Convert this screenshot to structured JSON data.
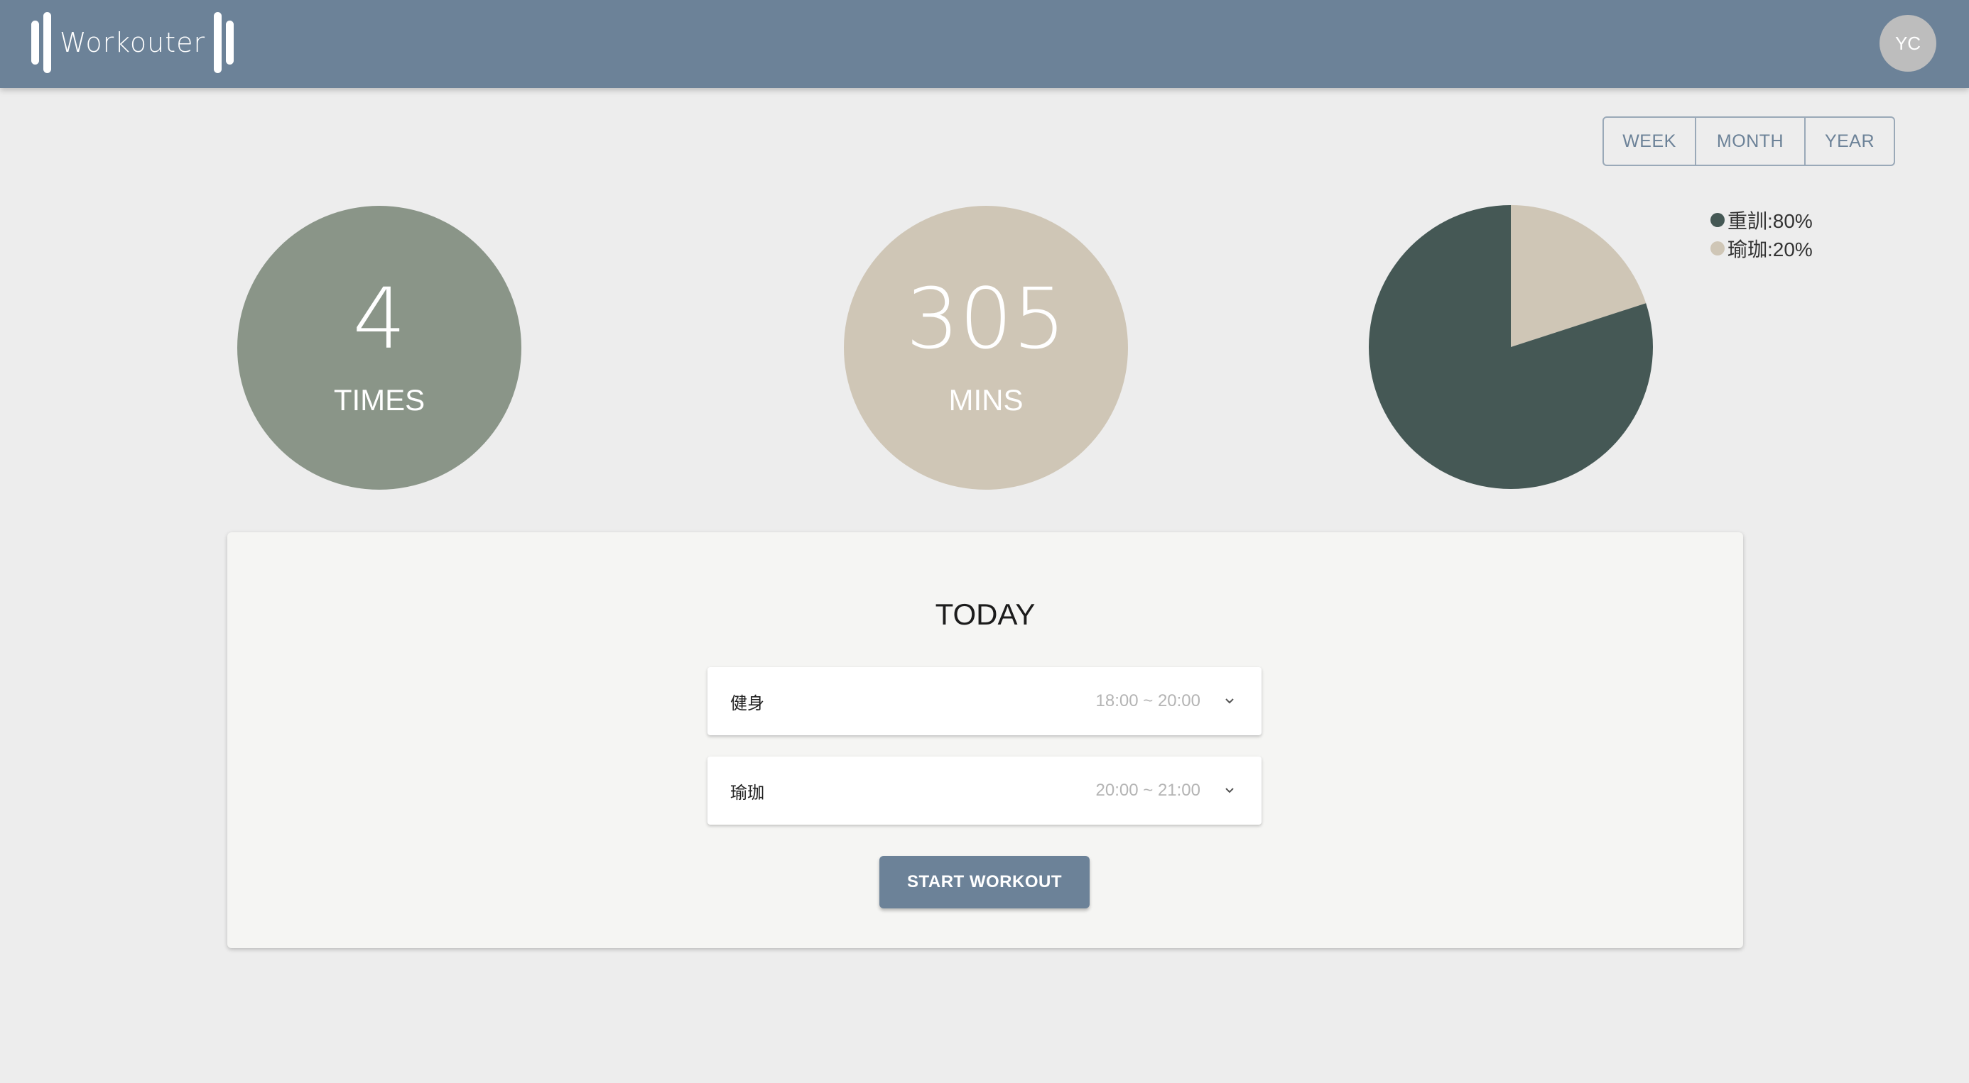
{
  "app": {
    "brand": "Workouter",
    "user_initials": "YC",
    "brand_color": "#6c8298"
  },
  "period_filter": {
    "options": [
      "WEEK",
      "MONTH",
      "YEAR"
    ]
  },
  "stats": {
    "times": {
      "value": "4",
      "label": "TIMES",
      "color": "#8a9588"
    },
    "minutes": {
      "value": "305",
      "label": "MINS",
      "color": "#cfc6b6"
    }
  },
  "chart_data": {
    "type": "pie",
    "slices": [
      {
        "label": "重訓",
        "value": 80,
        "color": "#455855"
      },
      {
        "label": "瑜珈",
        "value": 20,
        "color": "#cfc6b6"
      }
    ],
    "legend": [
      "重訓:80%",
      "瑜珈:20%"
    ],
    "legend_position": "top-right"
  },
  "today": {
    "title": "TODAY",
    "workouts": [
      {
        "name": "健身",
        "time": "18:00 ~ 20:00",
        "icon": "chevron-down-icon"
      },
      {
        "name": "瑜珈",
        "time": "20:00 ~ 21:00",
        "icon": "chevron-down-icon"
      }
    ],
    "start_button": "START WORKOUT"
  }
}
